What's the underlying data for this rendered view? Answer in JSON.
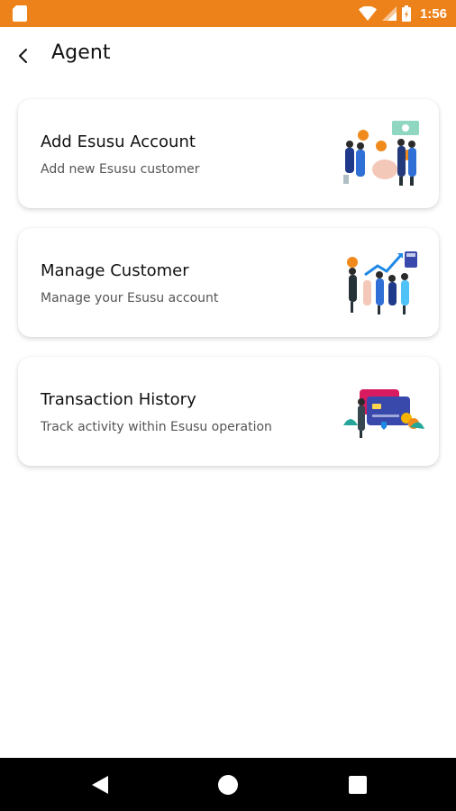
{
  "status_bar": {
    "time": "1:56",
    "background": "#EE821A",
    "icons": [
      "sd-card-icon",
      "wifi-icon",
      "signal-icon",
      "battery-icon"
    ]
  },
  "app_bar": {
    "title": "Agent",
    "back_icon": "back-arrow-icon"
  },
  "cards": [
    {
      "title": "Add Esusu Account",
      "subtitle": "Add new Esusu customer",
      "illustration": "people-money-illustration"
    },
    {
      "title": "Manage Customer",
      "subtitle": "Manage your Esusu account",
      "illustration": "growth-chart-illustration"
    },
    {
      "title": "Transaction History",
      "subtitle": "Track activity within Esusu operation",
      "illustration": "card-transaction-illustration"
    }
  ],
  "nav_bar": {
    "icons": [
      "nav-back-icon",
      "nav-home-icon",
      "nav-recents-icon"
    ]
  }
}
